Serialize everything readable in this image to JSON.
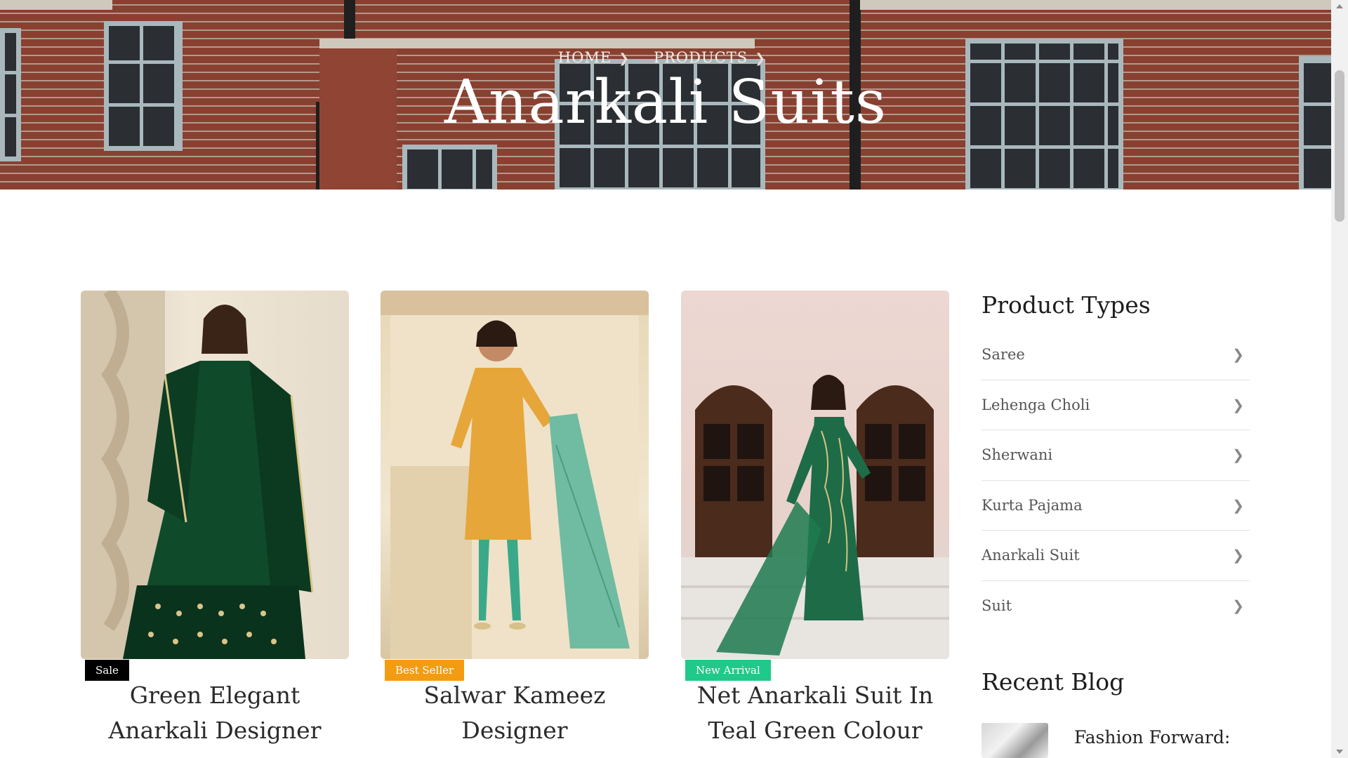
{
  "breadcrumb": {
    "home": "HOME",
    "products": "PRODUCTS"
  },
  "page": {
    "title": "Anarkali Suits"
  },
  "products": [
    {
      "badge": "Sale",
      "badge_color": "#000000",
      "title": "Green Elegant Anarkali Designer"
    },
    {
      "badge": "Best Seller",
      "badge_color": "#f39c12",
      "title": "Salwar Kameez Designer"
    },
    {
      "badge": "New Arrival",
      "badge_color": "#1fc98a",
      "title": "Net Anarkali Suit In Teal Green Colour"
    }
  ],
  "sidebar": {
    "product_types_heading": "Product Types",
    "types": [
      "Saree",
      "Lehenga Choli",
      "Sherwani",
      "Kurta Pajama",
      "Anarkali Suit",
      "Suit"
    ],
    "recent_blog_heading": "Recent Blog",
    "recent_blog_first_title": "Fashion Forward:"
  },
  "icons": {
    "breadcrumb_separator": "chevron-right-icon",
    "list_arrow": "chevron-right-icon"
  }
}
